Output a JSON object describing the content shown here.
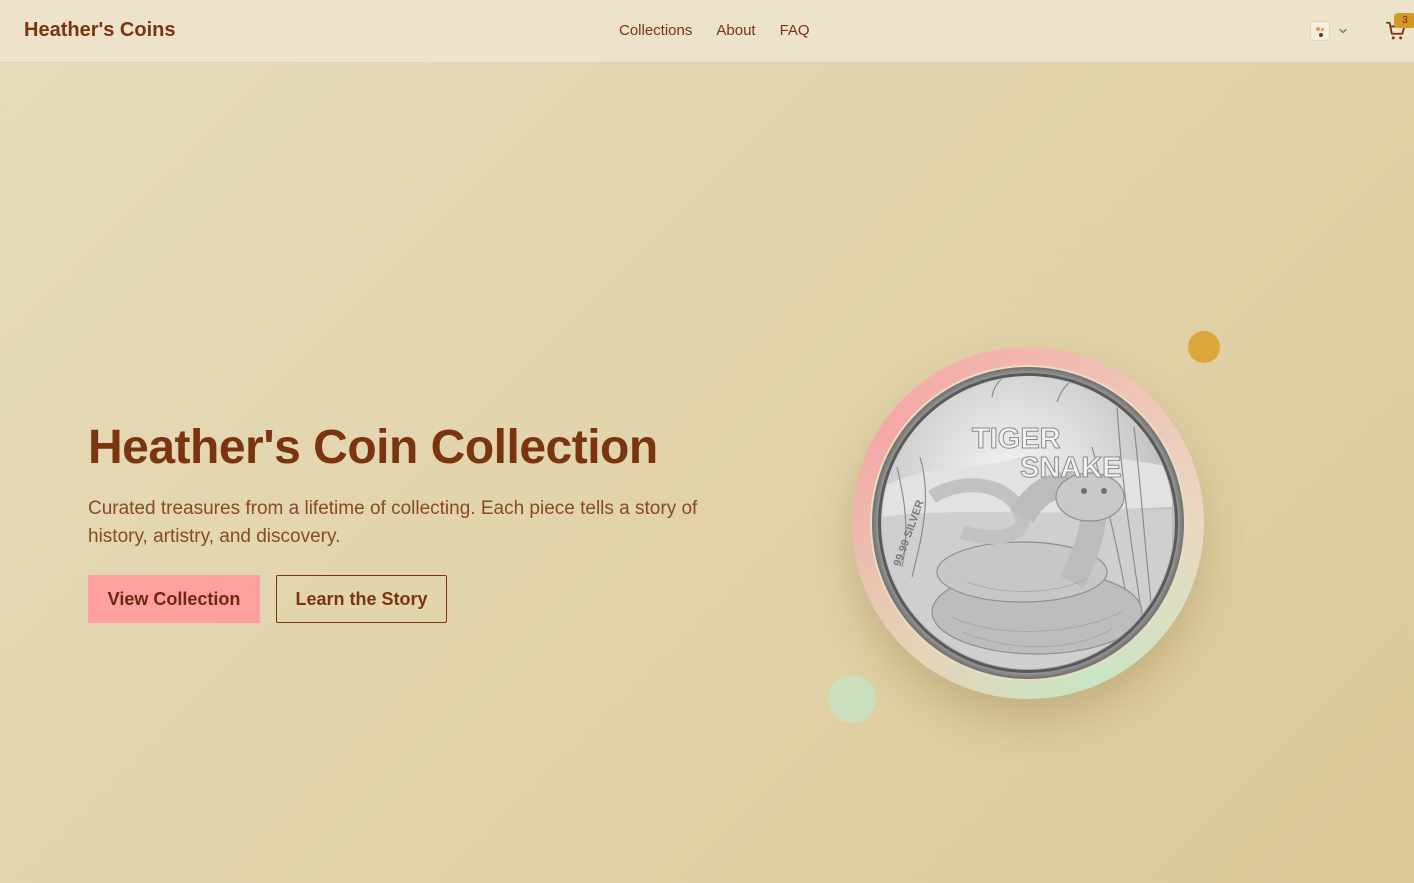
{
  "header": {
    "brand": "Heather's Coins",
    "nav": [
      "Collections",
      "About",
      "FAQ"
    ],
    "cart_count": "3"
  },
  "hero": {
    "title": "Heather's Coin Collection",
    "subtitle": "Curated treasures from a lifetime of collecting. Each piece tells a story of history, artistry, and discovery.",
    "primary_cta": "View Collection",
    "secondary_cta": "Learn the Story"
  },
  "coin": {
    "line1": "TIGER",
    "line2": "SNAKE"
  },
  "icons": {
    "theme": "palette-icon",
    "dropdown": "chevron-down-icon",
    "cart": "shopping-cart-icon"
  },
  "colors": {
    "brand": "#7a3410",
    "primary_button": "#ff9f9f",
    "badge": "#d39b25",
    "accent_gold": "#dba73a",
    "accent_green": "#cbe0bd"
  }
}
